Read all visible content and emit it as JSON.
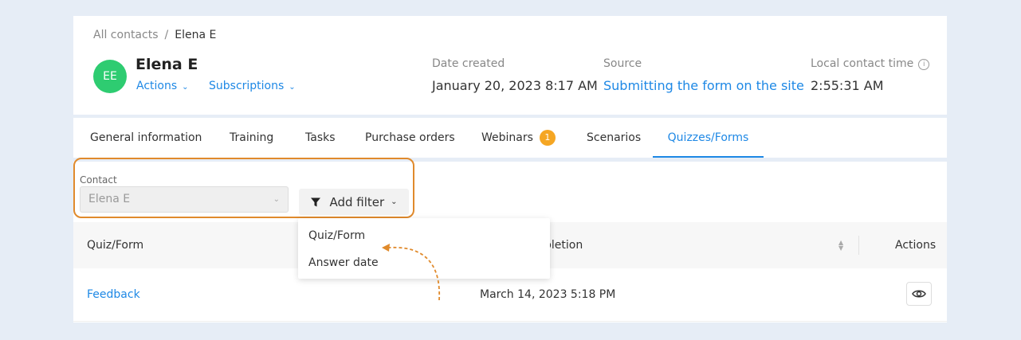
{
  "breadcrumb": {
    "root": "All contacts",
    "separator": "/",
    "current": "Elena E"
  },
  "contact": {
    "initials": "EE",
    "name": "Elena E",
    "avatar_color": "#2ecc71",
    "actions_label": "Actions",
    "subscriptions_label": "Subscriptions"
  },
  "meta": {
    "date_created_label": "Date created",
    "date_created_value": "January 20, 2023 8:17 AM",
    "source_label": "Source",
    "source_value": "Submitting the form on the site",
    "local_time_label": "Local contact time",
    "local_time_value": "2:55:31 AM"
  },
  "tabs": [
    {
      "label": "General information"
    },
    {
      "label": "Training"
    },
    {
      "label": "Tasks"
    },
    {
      "label": "Purchase orders"
    },
    {
      "label": "Webinars",
      "badge": "1"
    },
    {
      "label": "Scenarios"
    },
    {
      "label": "Quizzes/Forms",
      "active": true
    }
  ],
  "filters": {
    "contact_label": "Contact",
    "contact_value": "Elena E",
    "add_filter_label": "Add filter",
    "highlight_color": "#e08a2c"
  },
  "table": {
    "col_quiz": "Quiz/Form",
    "col_completion": "pletion",
    "col_actions": "Actions",
    "rows": [
      {
        "quiz": "Feedback",
        "completion": "March 14, 2023 5:18 PM"
      }
    ]
  },
  "dropdown": {
    "items": [
      "Quiz/Form",
      "Answer date"
    ]
  },
  "colors": {
    "accent": "#1e88e5",
    "badge": "#f5a623",
    "background": "#e6edf6"
  }
}
